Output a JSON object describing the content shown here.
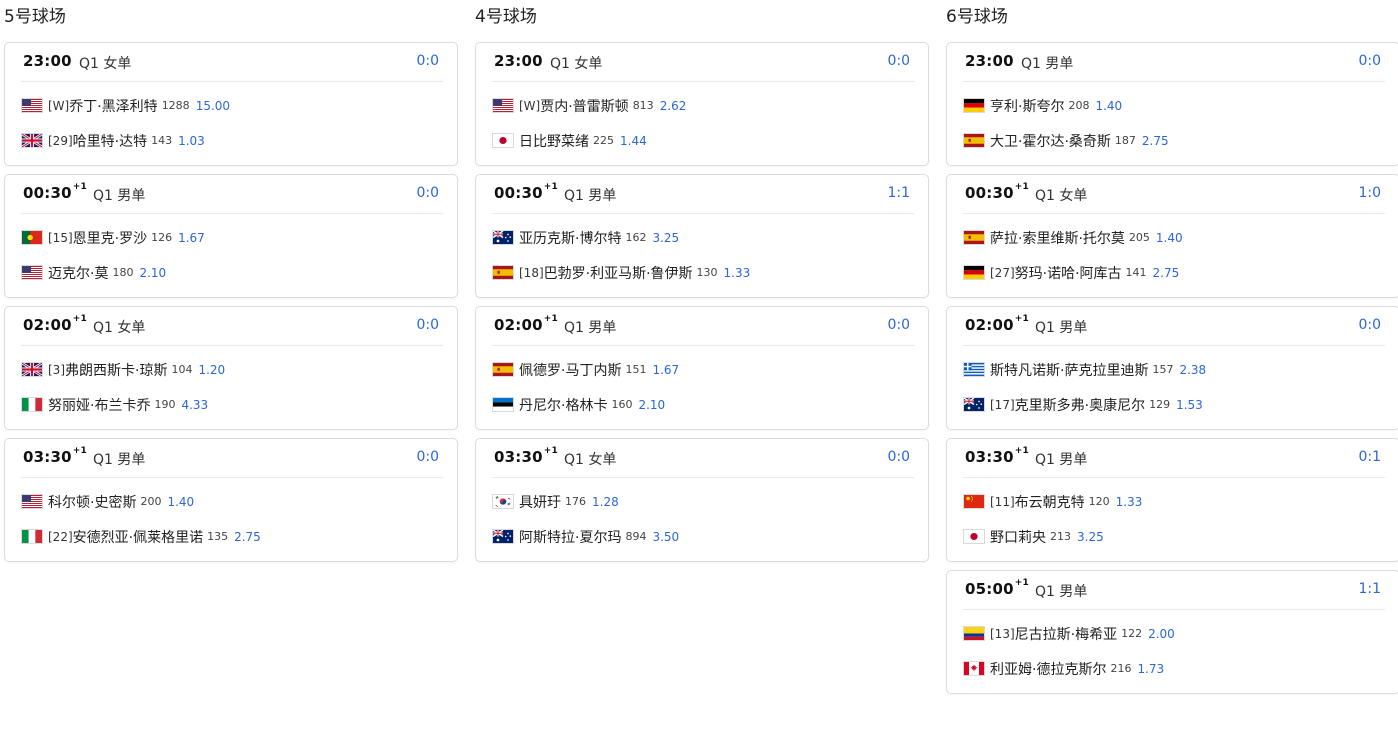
{
  "courts": [
    {
      "title": "5号球场",
      "matches": [
        {
          "time": "23:00",
          "next_day": "",
          "event": "Q1 女单",
          "score": "0:0",
          "players": [
            {
              "flag": "us",
              "seed": "[W]",
              "name": "乔丁·黑泽利特",
              "rank": "1288",
              "odds": "15.00"
            },
            {
              "flag": "gb",
              "seed": "[29]",
              "name": "哈里特·达特",
              "rank": "143",
              "odds": "1.03"
            }
          ]
        },
        {
          "time": "00:30",
          "next_day": "+1",
          "event": "Q1 男单",
          "score": "0:0",
          "players": [
            {
              "flag": "pt",
              "seed": "[15]",
              "name": "恩里克·罗沙",
              "rank": "126",
              "odds": "1.67"
            },
            {
              "flag": "us",
              "seed": "",
              "name": "迈克尔·莫",
              "rank": "180",
              "odds": "2.10"
            }
          ]
        },
        {
          "time": "02:00",
          "next_day": "+1",
          "event": "Q1 女单",
          "score": "0:0",
          "players": [
            {
              "flag": "gb",
              "seed": "[3]",
              "name": "弗朗西斯卡·琼斯",
              "rank": "104",
              "odds": "1.20"
            },
            {
              "flag": "it",
              "seed": "",
              "name": "努丽娅·布兰卡乔",
              "rank": "190",
              "odds": "4.33"
            }
          ]
        },
        {
          "time": "03:30",
          "next_day": "+1",
          "event": "Q1 男单",
          "score": "0:0",
          "players": [
            {
              "flag": "us",
              "seed": "",
              "name": "科尔顿·史密斯",
              "rank": "200",
              "odds": "1.40"
            },
            {
              "flag": "it",
              "seed": "[22]",
              "name": "安德烈亚·佩莱格里诺",
              "rank": "135",
              "odds": "2.75"
            }
          ]
        }
      ]
    },
    {
      "title": "4号球场",
      "matches": [
        {
          "time": "23:00",
          "next_day": "",
          "event": "Q1 女单",
          "score": "0:0",
          "players": [
            {
              "flag": "us",
              "seed": "[W]",
              "name": "贾内·普雷斯顿",
              "rank": "813",
              "odds": "2.62"
            },
            {
              "flag": "jp",
              "seed": "",
              "name": "日比野菜绪",
              "rank": "225",
              "odds": "1.44"
            }
          ]
        },
        {
          "time": "00:30",
          "next_day": "+1",
          "event": "Q1 男单",
          "score": "1:1",
          "players": [
            {
              "flag": "au",
              "seed": "",
              "name": "亚历克斯·博尔特",
              "rank": "162",
              "odds": "3.25"
            },
            {
              "flag": "es",
              "seed": "[18]",
              "name": "巴勃罗·利亚马斯·鲁伊斯",
              "rank": "130",
              "odds": "1.33"
            }
          ]
        },
        {
          "time": "02:00",
          "next_day": "+1",
          "event": "Q1 男单",
          "score": "0:0",
          "players": [
            {
              "flag": "es",
              "seed": "",
              "name": "佩德罗·马丁内斯",
              "rank": "151",
              "odds": "1.67"
            },
            {
              "flag": "ee",
              "seed": "",
              "name": "丹尼尔·格林卡",
              "rank": "160",
              "odds": "2.10"
            }
          ]
        },
        {
          "time": "03:30",
          "next_day": "+1",
          "event": "Q1 女单",
          "score": "0:0",
          "players": [
            {
              "flag": "kr",
              "seed": "",
              "name": "具妍玗",
              "rank": "176",
              "odds": "1.28"
            },
            {
              "flag": "au",
              "seed": "",
              "name": "阿斯特拉·夏尔玛",
              "rank": "894",
              "odds": "3.50"
            }
          ]
        }
      ]
    },
    {
      "title": "6号球场",
      "matches": [
        {
          "time": "23:00",
          "next_day": "",
          "event": "Q1 男单",
          "score": "0:0",
          "players": [
            {
              "flag": "de",
              "seed": "",
              "name": "亨利·斯夸尔",
              "rank": "208",
              "odds": "1.40"
            },
            {
              "flag": "es",
              "seed": "",
              "name": "大卫·霍尔达·桑奇斯",
              "rank": "187",
              "odds": "2.75"
            }
          ]
        },
        {
          "time": "00:30",
          "next_day": "+1",
          "event": "Q1 女单",
          "score": "1:0",
          "players": [
            {
              "flag": "es",
              "seed": "",
              "name": "萨拉·索里维斯·托尔莫",
              "rank": "205",
              "odds": "1.40"
            },
            {
              "flag": "de",
              "seed": "[27]",
              "name": "努玛·诺哈·阿库古",
              "rank": "141",
              "odds": "2.75"
            }
          ]
        },
        {
          "time": "02:00",
          "next_day": "+1",
          "event": "Q1 男单",
          "score": "0:0",
          "players": [
            {
              "flag": "gr",
              "seed": "",
              "name": "斯特凡诺斯·萨克拉里迪斯",
              "rank": "157",
              "odds": "2.38"
            },
            {
              "flag": "au",
              "seed": "[17]",
              "name": "克里斯多弗·奥康尼尔",
              "rank": "129",
              "odds": "1.53"
            }
          ]
        },
        {
          "time": "03:30",
          "next_day": "+1",
          "event": "Q1 男单",
          "score": "0:1",
          "players": [
            {
              "flag": "cn",
              "seed": "[11]",
              "name": "布云朝克特",
              "rank": "120",
              "odds": "1.33"
            },
            {
              "flag": "jp",
              "seed": "",
              "name": "野口莉央",
              "rank": "213",
              "odds": "3.25"
            }
          ]
        },
        {
          "time": "05:00",
          "next_day": "+1",
          "event": "Q1 男单",
          "score": "1:1",
          "players": [
            {
              "flag": "co",
              "seed": "[13]",
              "name": "尼古拉斯·梅希亚",
              "rank": "122",
              "odds": "2.00"
            },
            {
              "flag": "ca",
              "seed": "",
              "name": "利亚姆·德拉克斯尔",
              "rank": "216",
              "odds": "1.73"
            }
          ]
        }
      ]
    }
  ]
}
